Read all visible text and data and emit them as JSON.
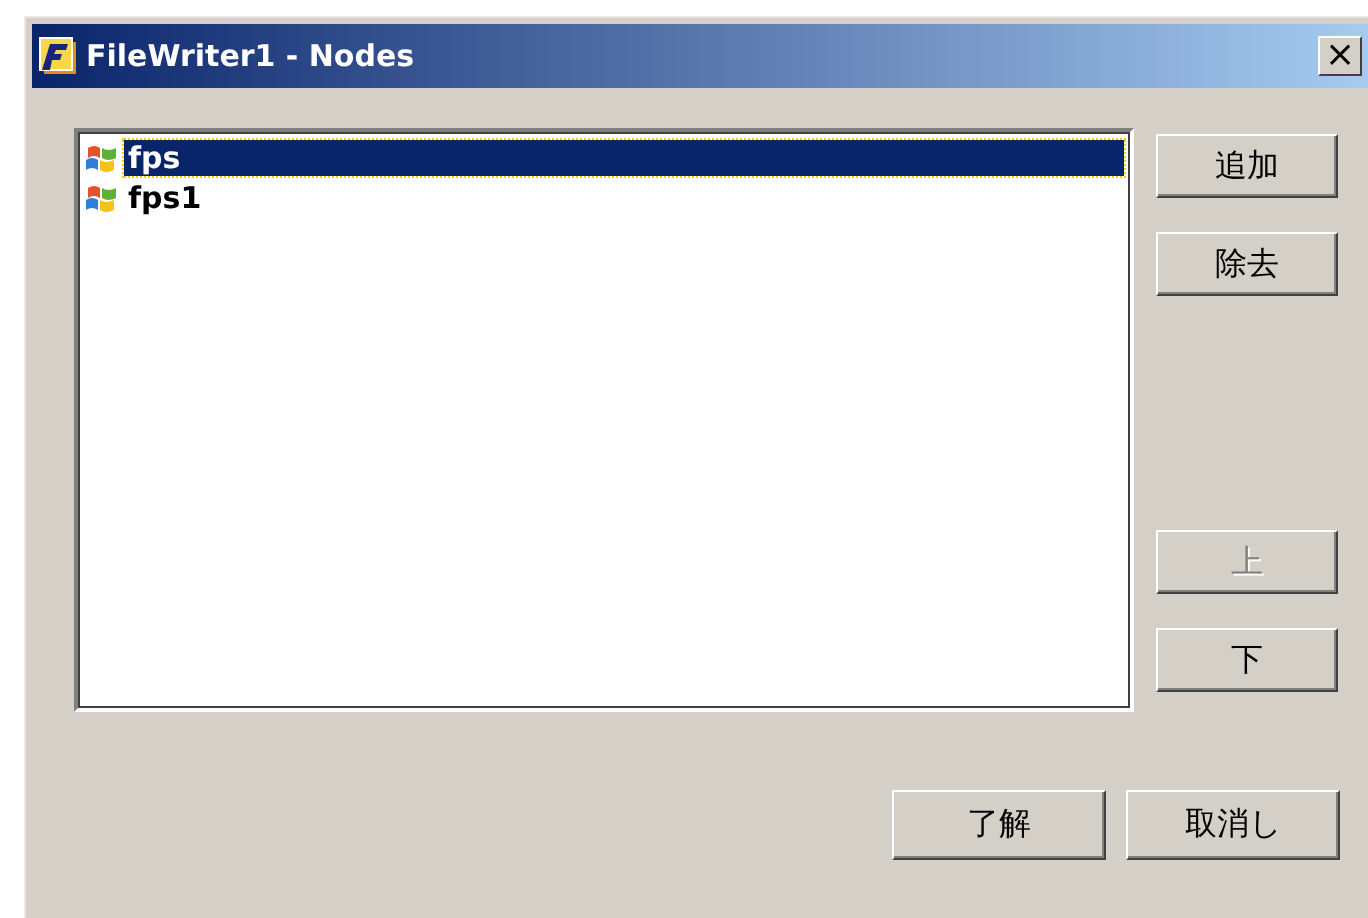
{
  "window": {
    "title": "FileWriter1 - Nodes",
    "close": "×"
  },
  "nodes": [
    {
      "label": "fps",
      "selected": true
    },
    {
      "label": "fps1",
      "selected": false
    }
  ],
  "side_buttons": [
    {
      "label": "追加",
      "disabled": false
    },
    {
      "label": "除去",
      "disabled": false
    },
    {
      "label": "上",
      "disabled": true
    },
    {
      "label": "下",
      "disabled": false
    }
  ],
  "footer_buttons": [
    {
      "label": "了解"
    },
    {
      "label": "取消し"
    }
  ]
}
